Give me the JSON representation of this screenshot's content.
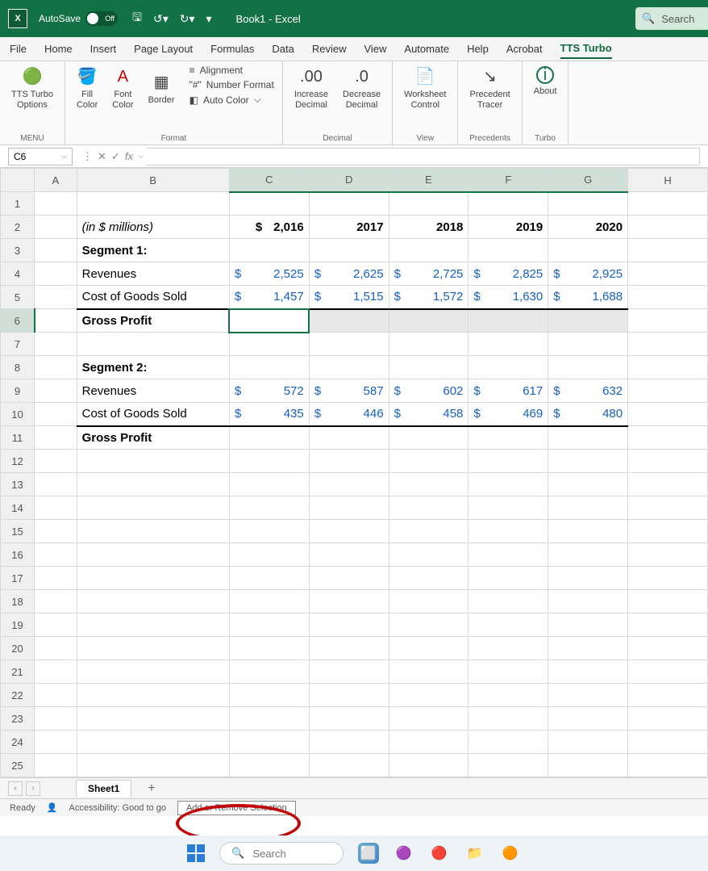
{
  "title": {
    "autosave": "AutoSave",
    "toggle": "Off",
    "doc": "Book1  -  Excel",
    "search": "Search"
  },
  "menu": {
    "tabs": [
      "File",
      "Home",
      "Insert",
      "Page Layout",
      "Formulas",
      "Data",
      "Review",
      "View",
      "Automate",
      "Help",
      "Acrobat",
      "TTS Turbo"
    ],
    "active": "TTS Turbo"
  },
  "ribbon": {
    "g1": {
      "btn": "TTS Turbo\nOptions",
      "label": "MENU"
    },
    "g2": {
      "b1": "Fill\nColor",
      "b2": "Font\nColor",
      "b3": "Border",
      "i1": "Alignment",
      "i2": "Number Format",
      "i3": "Auto Color",
      "label": "Format"
    },
    "g3": {
      "b1": "Increase\nDecimal",
      "b2": "Decrease\nDecimal",
      "label": "Decimal"
    },
    "g4": {
      "b1": "Worksheet\nControl",
      "label": "View"
    },
    "g5": {
      "b1": "Precedent\nTracer",
      "label": "Precedents"
    },
    "g6": {
      "b1": "About",
      "label": "Turbo"
    }
  },
  "fbar": {
    "cell": "C6"
  },
  "cols": [
    "A",
    "B",
    "C",
    "D",
    "E",
    "F",
    "G",
    "H"
  ],
  "rows": 25,
  "data": {
    "r2": {
      "B": "(in $ millions)",
      "C_cur": "$",
      "C": "2,016",
      "D": "2017",
      "E": "2018",
      "F": "2019",
      "G": "2020"
    },
    "r3": {
      "B": "Segment 1:"
    },
    "r4": {
      "B": "Revenues",
      "C": "2,525",
      "D": "2,625",
      "E": "2,725",
      "F": "2,825",
      "G": "2,925"
    },
    "r5": {
      "B": "Cost of Goods Sold",
      "C": "1,457",
      "D": "1,515",
      "E": "1,572",
      "F": "1,630",
      "G": "1,688"
    },
    "r6": {
      "B": "Gross Profit"
    },
    "r8": {
      "B": "Segment 2:"
    },
    "r9": {
      "B": "Revenues",
      "C": "572",
      "D": "587",
      "E": "602",
      "F": "617",
      "G": "632"
    },
    "r10": {
      "B": "Cost of Goods Sold",
      "C": "435",
      "D": "446",
      "E": "458",
      "F": "469",
      "G": "480"
    },
    "r11": {
      "B": "Gross Profit"
    }
  },
  "sheetTab": "Sheet1",
  "status": {
    "ready": "Ready",
    "acc": "Accessibility: Good to go",
    "mode": "Add or Remove Selection"
  },
  "taskbar": {
    "search": "Search"
  }
}
